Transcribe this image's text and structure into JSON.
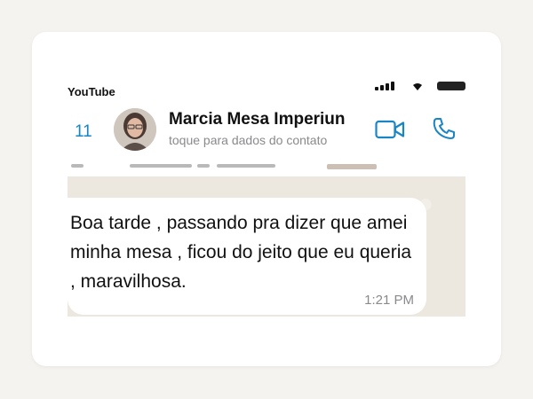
{
  "status_bar": {
    "back_app_label": "YouTube"
  },
  "header": {
    "back_count": "11",
    "contact_name": "Marcia Mesa Imperiun",
    "subtitle": "toque para dados do contato",
    "icons": [
      "video-camera-icon",
      "phone-icon"
    ]
  },
  "message": {
    "text": "Boa tarde , passando pra dizer que amei minha mesa , ficou do jeito que eu queria , maravilhosa.",
    "time": "1:21 PM"
  },
  "colors": {
    "accent": "#1a85c4",
    "chat_background": "#ece8e0",
    "bubble": "#ffffff"
  }
}
